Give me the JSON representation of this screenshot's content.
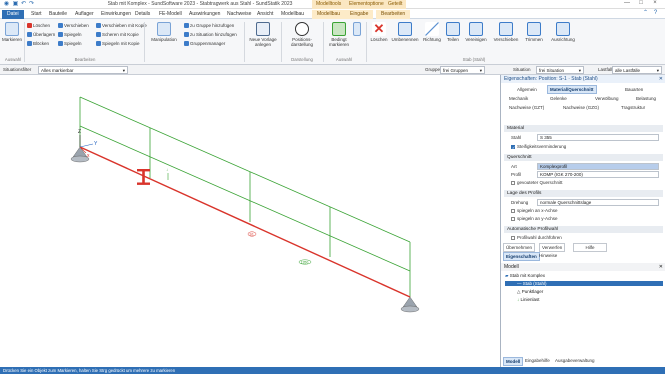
{
  "window": {
    "title": "Stab mit Komplex - SundSoftware 2023 - Stabtragwerk aus Stahl - SundStatik 2023",
    "context_tabs": [
      "Modelltools",
      "Elementoptionen",
      "Geteilt"
    ],
    "buttons": [
      "—",
      "□",
      "×"
    ]
  },
  "ribbon_tabs": [
    {
      "label": "Datei",
      "active": true
    },
    {
      "label": "Start"
    },
    {
      "label": "Bauteile"
    },
    {
      "label": "Auflager"
    },
    {
      "label": "Einwirkungen"
    },
    {
      "label": "Details"
    },
    {
      "label": "FE-Modell"
    },
    {
      "label": "Auswirkungen"
    },
    {
      "label": "Nachweise"
    },
    {
      "label": "Ansicht"
    },
    {
      "label": "Modellbau"
    },
    {
      "label": "Modellbau",
      "ctx": true
    },
    {
      "label": "Eingabe",
      "ctx": true
    },
    {
      "label": "Bearbeiten",
      "ctx": true
    }
  ],
  "ribbon": {
    "markieren": "Markieren",
    "auswahl_group": "Auswahl",
    "small_col1": [
      "Löschen",
      "Überlagern",
      "Blöcken"
    ],
    "small_col2": [
      "Verschieben",
      "Spiegeln",
      "Spiegeln"
    ],
    "small_col3": [
      "Verschieben mit Kopie",
      "Scheren mit Kopie",
      "Spiegeln mit Kopie"
    ],
    "bearbeiten_group": "Bearbeiten",
    "manipulation": "Manipulation",
    "small_col4": [
      "zu Gruppe hinzufügen",
      "zu Situation hinzufügen",
      "Gruppenmanager"
    ],
    "neue_vorlage": "Neue Vorlage anlegen",
    "positionsdarstellung": "Positions-darstellung",
    "darstellung_group": "Darstellung",
    "bedingt_markieren": "Bedingt markieren",
    "auswahl2_group": "Auswahl",
    "right_buttons": [
      "Löschen",
      "Umbenennen",
      "Richtung",
      "Teilen",
      "Vereinigen",
      "Verschieben",
      "Trimmen",
      "Ausrichtung"
    ],
    "stab_group": "Stab (Stahl)"
  },
  "toolrow": {
    "filter_label": "Situationsfilter",
    "filter_value": "Alles markierbar",
    "gruppe_label": "Gruppe",
    "gruppe_value": "frei Gruppen",
    "situation_label": "Situation",
    "situation_value": "frei Situation",
    "lastfall_label": "Lastfall",
    "lastfall_value": "alle Lastfälle"
  },
  "viewport": {
    "axis_x": "x",
    "axis_y": "Y",
    "axis_z": "Z",
    "labels": [
      "S1",
      "1350"
    ]
  },
  "props": {
    "title": "Eigenschaften: Position: S-1 · Stab (Stahl)",
    "tabs_row1": [
      "Allgemein",
      "Material/Querschnitt",
      "Bauarten"
    ],
    "tabs_row2": [
      "Mechanik",
      "Gelenke",
      "Verwölbung",
      "Belastung"
    ],
    "tabs_row3": [
      "Nachweise (GZT)",
      "Nachweise (GZG)",
      "Tragstruktur"
    ],
    "material_section": "Material",
    "stahl_label": "Stahl",
    "stahl_value": "S 355",
    "steifigkeit": "Steifigkeitsverminderung",
    "querschnitt_section": "Querschnitt",
    "art_label": "Art",
    "art_value": "Komplexprofil",
    "profil_label": "Profil",
    "profil_value": "KOMP (IGK 270-200)",
    "gevoutet": "gevouteter Querschnitt",
    "lage_section": "Lage des Profils",
    "drehung_label": "Drehung",
    "drehung_value": "normale Querschnittslage",
    "spiegel1": "spiegeln an x-Achse",
    "spiegel2": "spiegeln an y-Achse",
    "auto_section": "Automatische Profilwahl",
    "auto_check": "Profilwahl durchführen",
    "bottom_buttons": [
      "Übernehmen",
      "Verwerfen",
      "Hilfe"
    ],
    "bottom_tabs": [
      "Eigenschaften",
      "Hinweise"
    ]
  },
  "model": {
    "title": "Modell",
    "items": [
      {
        "label": "Stab mit Komplex",
        "level": 0
      },
      {
        "label": "Stab (Stahl)",
        "level": 1,
        "selected": true
      },
      {
        "label": "Punktlager",
        "level": 1
      },
      {
        "label": "Linienlast",
        "level": 1
      }
    ],
    "bottom_tabs": [
      "Modell",
      "Eingabehilfe",
      "Ausgabeverwaltung"
    ]
  },
  "status": {
    "text": "Drücken Sie ein Objekt zum Markieren, halten Sie Strg gedrückt um mehrere zu markieren"
  },
  "colors": {
    "accent": "#2f6fb5",
    "beam": "#d9342b",
    "load": "#3aa335"
  }
}
